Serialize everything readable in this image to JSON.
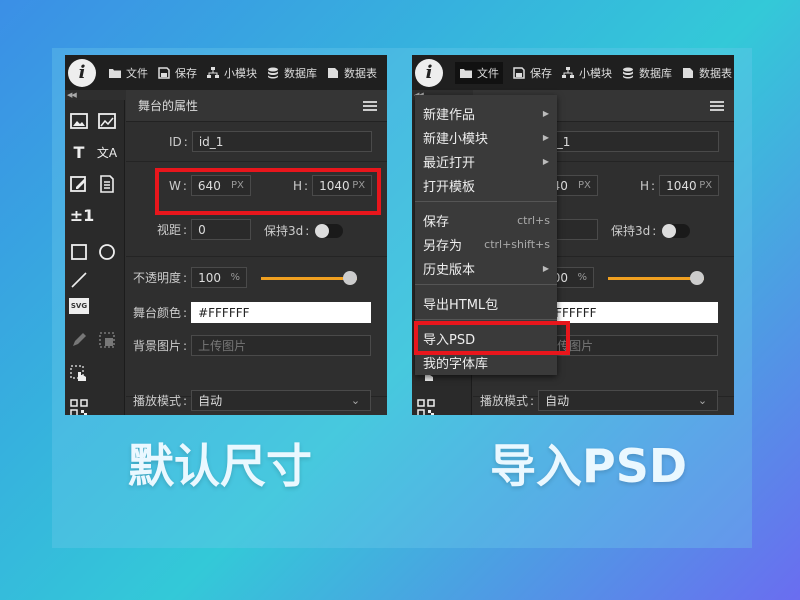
{
  "colors": {
    "accent_red": "#e8161c",
    "slider_orange": "#f0a020",
    "panel_bg": "#2f2f2f"
  },
  "toolbar_top": {
    "logo": "i",
    "items": [
      {
        "label": "文件",
        "icon": "folder-icon"
      },
      {
        "label": "保存",
        "icon": "save-icon"
      },
      {
        "label": "小模块",
        "icon": "modules-icon"
      },
      {
        "label": "数据库",
        "icon": "database-icon"
      },
      {
        "label": "数据表",
        "icon": "data-table-icon"
      }
    ]
  },
  "collapse_glyph": "◀◀",
  "tools": [
    "image-icon",
    "image-edit-icon",
    "text-icon",
    "translate-icon",
    "edit-icon",
    "document-icon",
    "number-icon",
    "rectangle-icon",
    "circle-icon",
    "line-icon",
    "svg-icon",
    "pen-icon",
    "crop-icon",
    "select-icon",
    "qr-icon"
  ],
  "tool_text": {
    "text": "T",
    "translate": "文A",
    "number": "±1",
    "svg": "SVG"
  },
  "props": {
    "title": "舞台的属性",
    "id_label": "ID",
    "id_value": "id_1",
    "w_label": "W",
    "w_value": "640",
    "h_label": "H",
    "h_value": "1040",
    "unit_px": "PX",
    "fov_label": "视距",
    "fov_value": "0",
    "keep3d_label": "保持3d",
    "opacity_label": "不透明度",
    "opacity_value": "100",
    "opacity_unit": "%",
    "opacity_level": 1.0,
    "stage_color_label": "舞台颜色",
    "stage_color_value": "#FFFFFF",
    "bg_image_label": "背景图片",
    "bg_image_placeholder": "上传图片",
    "play_mode_label": "播放模式",
    "play_mode_value": "自动",
    "colon": ":"
  },
  "menu": {
    "group1": [
      {
        "label": "新建作品",
        "arrow": "▶"
      },
      {
        "label": "新建小模块",
        "arrow": "▶"
      },
      {
        "label": "最近打开",
        "arrow": "▶"
      },
      {
        "label": "打开模板",
        "arrow": ""
      }
    ],
    "group2": [
      {
        "label": "保存",
        "shortcut": "ctrl+s",
        "arrow": ""
      },
      {
        "label": "另存为",
        "shortcut": "ctrl+shift+s",
        "arrow": ""
      },
      {
        "label": "历史版本",
        "shortcut": "",
        "arrow": "▶"
      }
    ],
    "export_html": "导出HTML包",
    "import_psd": "导入PSD",
    "font_library": "我的字体库"
  },
  "captions": {
    "left": "默认尺寸",
    "right": "导入PSD"
  }
}
